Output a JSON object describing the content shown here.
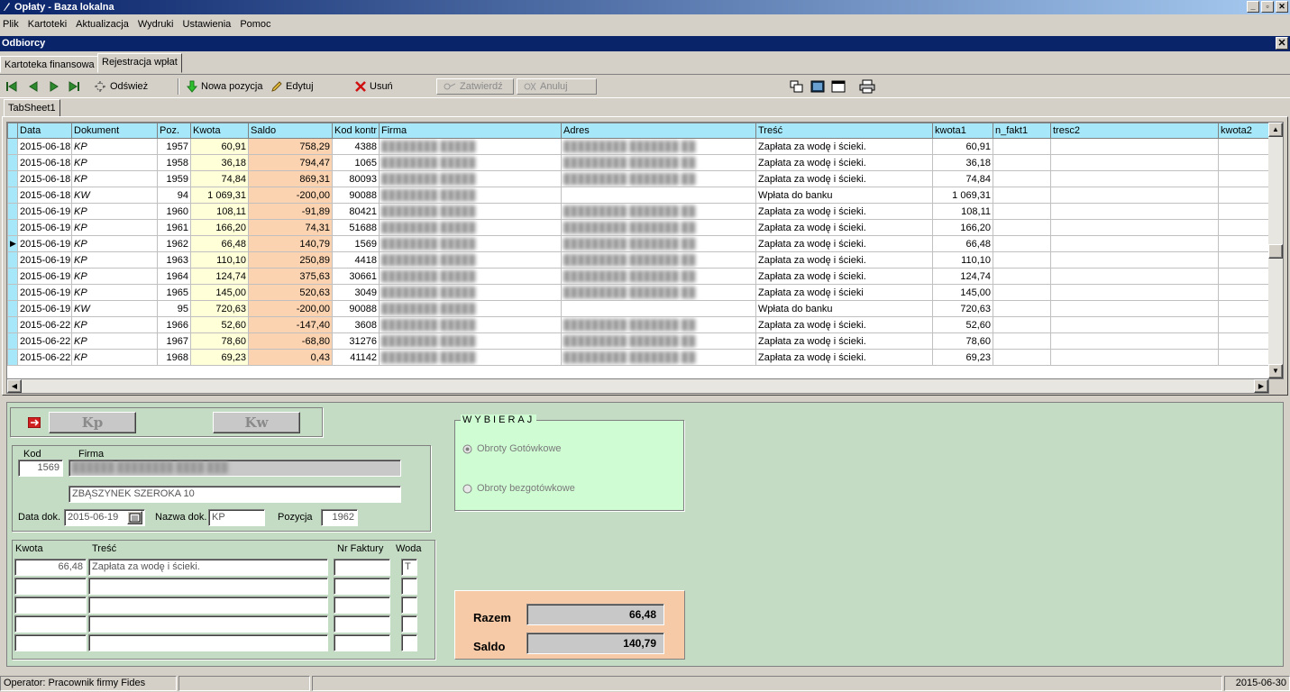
{
  "window": {
    "title": "Opłaty - Baza lokalna",
    "min": "_",
    "restore": "▫",
    "close": "✕"
  },
  "menu": [
    "Plik",
    "Kartoteki",
    "Aktualizacja",
    "Wydruki",
    "Ustawienia",
    "Pomoc"
  ],
  "mdi": {
    "title": "Odbiorcy",
    "close": "✕"
  },
  "tabs": [
    "Kartoteka finansowa",
    "Rejestracja wpłat"
  ],
  "toolbar": {
    "refresh": "Odśwież",
    "new": "Nowa pozycja",
    "edit": "Edytuj",
    "delete": "Usuń",
    "confirm": "Zatwierdź",
    "cancel": "Anuluj"
  },
  "inner_tab": "TabSheet1",
  "columns": [
    "Data",
    "Dokument",
    "Poz.",
    "Kwota",
    "Saldo",
    "Kod kontr",
    "Firma",
    "Adres",
    "Treść",
    "kwota1",
    "n_fakt1",
    "tresc2",
    "kwota2"
  ],
  "rows": [
    [
      "2015-06-18",
      "KP",
      "1957",
      "60,91",
      "758,29",
      "4388",
      "Zapłata za wodę i ścieki.",
      "60,91"
    ],
    [
      "2015-06-18",
      "KP",
      "1958",
      "36,18",
      "794,47",
      "1065",
      "Zapłata za wodę i ścieki.",
      "36,18"
    ],
    [
      "2015-06-18",
      "KP",
      "1959",
      "74,84",
      "869,31",
      "80093",
      "Zapłata za wodę i ścieki.",
      "74,84"
    ],
    [
      "2015-06-18",
      "KW",
      "94",
      "1 069,31",
      "-200,00",
      "90088",
      "Wpłata do banku",
      "1 069,31"
    ],
    [
      "2015-06-19",
      "KP",
      "1960",
      "108,11",
      "-91,89",
      "80421",
      "Zapłata za wodę i ścieki.",
      "108,11"
    ],
    [
      "2015-06-19",
      "KP",
      "1961",
      "166,20",
      "74,31",
      "51688",
      "Zapłata za wodę i ścieki.",
      "166,20"
    ],
    [
      "2015-06-19",
      "KP",
      "1962",
      "66,48",
      "140,79",
      "1569",
      "Zapłata za wodę i ścieki.",
      "66,48"
    ],
    [
      "2015-06-19",
      "KP",
      "1963",
      "110,10",
      "250,89",
      "4418",
      "Zapłata za wodę i ścieki.",
      "110,10"
    ],
    [
      "2015-06-19",
      "KP",
      "1964",
      "124,74",
      "375,63",
      "30661",
      "Zapłata za wodę i ścieki.",
      "124,74"
    ],
    [
      "2015-06-19",
      "KP",
      "1965",
      "145,00",
      "520,63",
      "3049",
      "Zapłata za wodę i ścieki",
      "145,00"
    ],
    [
      "2015-06-19",
      "KW",
      "95",
      "720,63",
      "-200,00",
      "90088",
      "Wpłata do banku",
      "720,63"
    ],
    [
      "2015-06-22",
      "KP",
      "1966",
      "52,60",
      "-147,40",
      "3608",
      "Zapłata za wodę i ścieki.",
      "52,60"
    ],
    [
      "2015-06-22",
      "KP",
      "1967",
      "78,60",
      "-68,80",
      "31276",
      "Zapłata za wodę i ścieki.",
      "78,60"
    ],
    [
      "2015-06-22",
      "KP",
      "1968",
      "69,23",
      "0,43",
      "41142",
      "Zapłata za wodę i ścieki.",
      "69,23"
    ]
  ],
  "current_row_index": 6,
  "form": {
    "kp": "Kp",
    "kw": "Kw",
    "kod_label": "Kod",
    "kod": "1569",
    "firma_label": "Firma",
    "adres": "ZBĄSZYNEK SZEROKA 10",
    "data_label": "Data dok.",
    "data": "2015-06-19",
    "nazwa_label": "Nazwa dok.",
    "nazwa": "KP",
    "pozycja_label": "Pozycja",
    "pozycja": "1962",
    "kwota_label": "Kwota",
    "tresc_label": "Treść",
    "nrf_label": "Nr Faktury",
    "woda_label": "Woda",
    "line_kwota": "66,48",
    "line_tresc": "Zapłata za wodę i ścieki.",
    "line_woda": "T"
  },
  "wybieraj": {
    "title": "WYBIERAJ",
    "opt1": "Obroty Gotówkowe",
    "opt2": "Obroty bezgotówkowe",
    "selected": "Obroty Gotówkowe"
  },
  "totals": {
    "razem_label": "Razem",
    "razem": "66,48",
    "saldo_label": "Saldo",
    "saldo": "140,79"
  },
  "status": {
    "operator": "Operator: Pracownik firmy Fides",
    "date": "2015-06-30"
  }
}
